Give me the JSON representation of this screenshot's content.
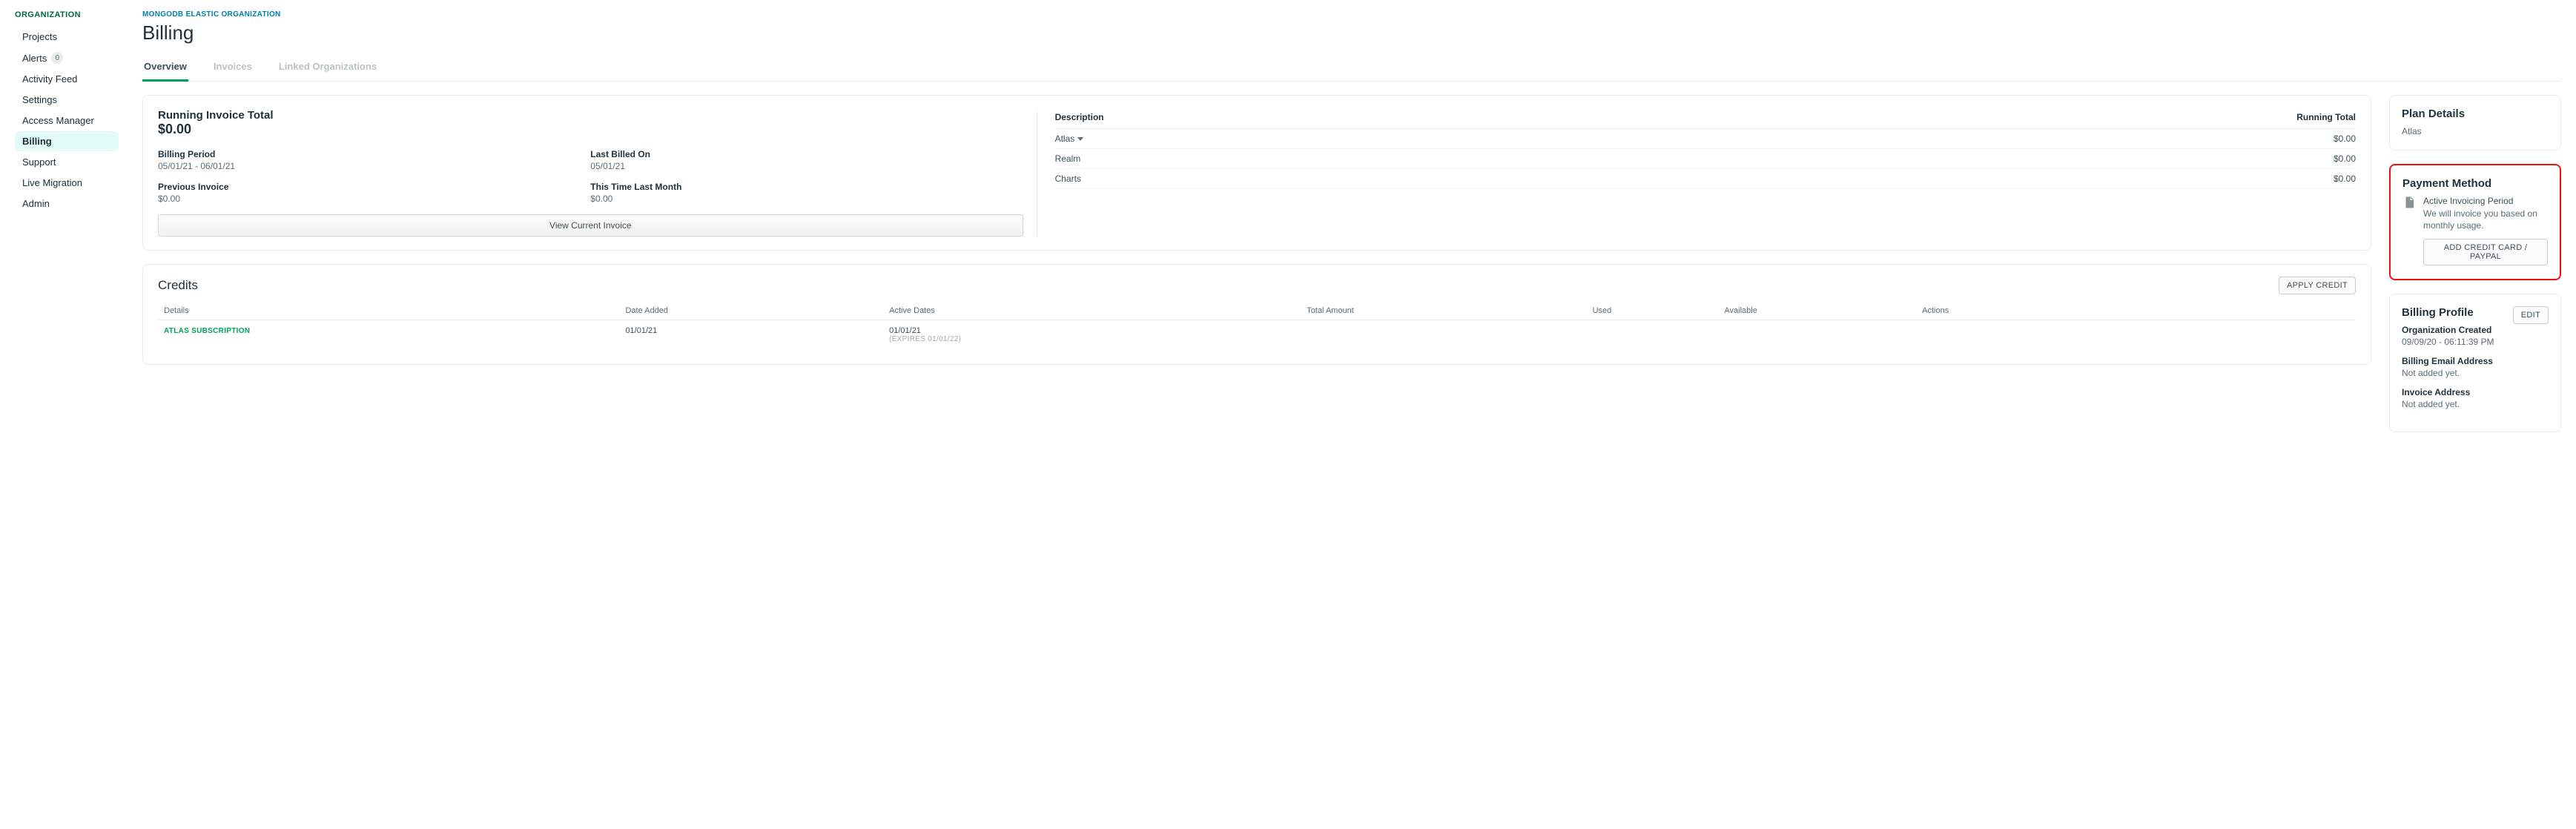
{
  "sidebar": {
    "heading": "ORGANIZATION",
    "items": [
      {
        "label": "Projects"
      },
      {
        "label": "Alerts",
        "badge": "0"
      },
      {
        "label": "Activity Feed"
      },
      {
        "label": "Settings"
      },
      {
        "label": "Access Manager"
      },
      {
        "label": "Billing",
        "active": true
      },
      {
        "label": "Support"
      },
      {
        "label": "Live Migration"
      },
      {
        "label": "Admin"
      }
    ]
  },
  "breadcrumb": "MONGODB ELASTIC ORGANIZATION",
  "page_title": "Billing",
  "tabs": [
    {
      "label": "Overview",
      "active": true
    },
    {
      "label": "Invoices"
    },
    {
      "label": "Linked Organizations"
    }
  ],
  "running": {
    "title": "Running Invoice Total",
    "amount": "$0.00",
    "billing_period_label": "Billing Period",
    "billing_period_value": "05/01/21 - 06/01/21",
    "last_billed_label": "Last Billed On",
    "last_billed_value": "05/01/21",
    "previous_invoice_label": "Previous Invoice",
    "previous_invoice_value": "$0.00",
    "this_time_label": "This Time Last Month",
    "this_time_value": "$0.00",
    "view_invoice_btn": "View Current Invoice"
  },
  "desc": {
    "col_description": "Description",
    "col_total": "Running Total",
    "rows": [
      {
        "name": "Atlas",
        "expandable": true,
        "total": "$0.00"
      },
      {
        "name": "Realm",
        "total": "$0.00"
      },
      {
        "name": "Charts",
        "total": "$0.00"
      }
    ]
  },
  "credits": {
    "title": "Credits",
    "apply_btn": "APPLY CREDIT",
    "cols": {
      "details": "Details",
      "date_added": "Date Added",
      "active_dates": "Active Dates",
      "total_amount": "Total Amount",
      "used": "Used",
      "available": "Available",
      "actions": "Actions"
    },
    "row": {
      "details": "ATLAS SUBSCRIPTION",
      "date_added": "01/01/21",
      "active_start": "01/01/21",
      "expires": "(EXPIRES  01/01/22)"
    }
  },
  "plan": {
    "title": "Plan Details",
    "value": "Atlas"
  },
  "payment": {
    "title": "Payment Method",
    "sub_title": "Active Invoicing Period",
    "desc": "We will invoice you based on monthly usage.",
    "btn": "ADD CREDIT CARD / PAYPAL"
  },
  "profile": {
    "title": "Billing Profile",
    "edit_btn": "EDIT",
    "org_created_label": "Organization Created",
    "org_created_value": "09/09/20 - 06:11:39 PM",
    "email_label": "Billing Email Address",
    "email_value": "Not added yet.",
    "address_label": "Invoice Address",
    "address_value": "Not added yet."
  }
}
